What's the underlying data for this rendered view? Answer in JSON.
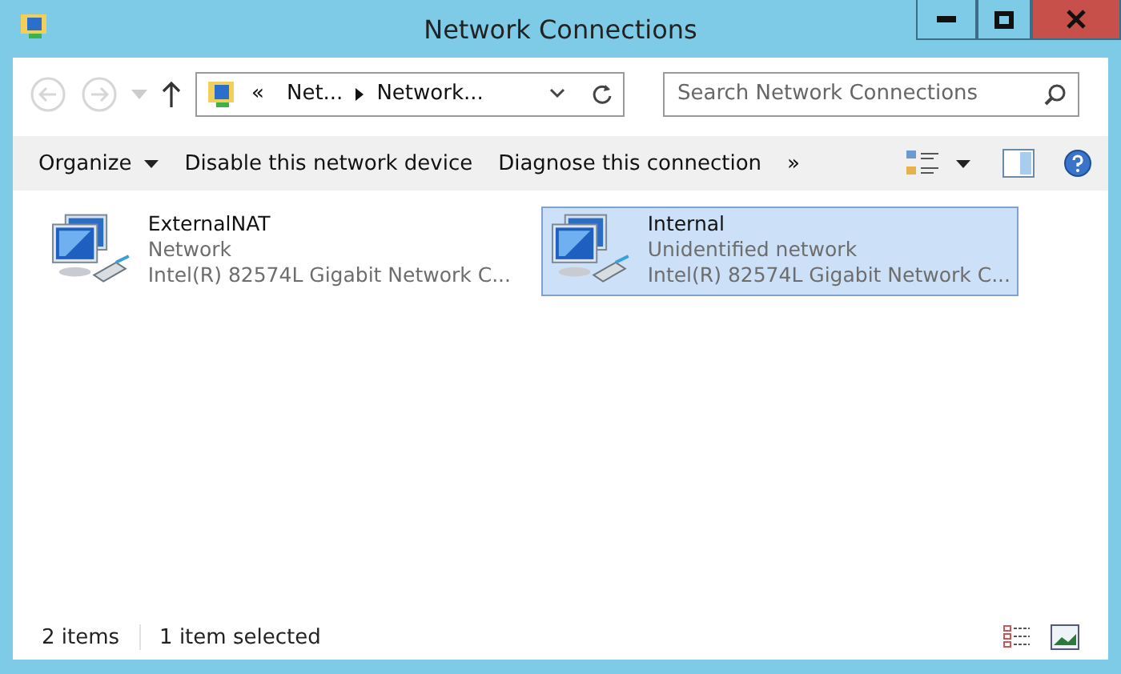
{
  "window": {
    "title": "Network Connections"
  },
  "address_bar": {
    "overflow": "«",
    "segments": [
      "Net...",
      "Network..."
    ]
  },
  "search": {
    "placeholder": "Search Network Connections"
  },
  "command_bar": {
    "items": [
      {
        "label": "Organize",
        "dropdown": true
      },
      {
        "label": "Disable this network device",
        "dropdown": false
      },
      {
        "label": "Diagnose this connection",
        "dropdown": false
      }
    ],
    "more": "»"
  },
  "connections": [
    {
      "name": "ExternalNAT",
      "status": "Network",
      "adapter": "Intel(R) 82574L Gigabit Network C...",
      "selected": false
    },
    {
      "name": "Internal",
      "status": "Unidentified network",
      "adapter": "Intel(R) 82574L Gigabit Network C...",
      "selected": true
    }
  ],
  "status_bar": {
    "count": "2 items",
    "selection": "1 item selected"
  }
}
